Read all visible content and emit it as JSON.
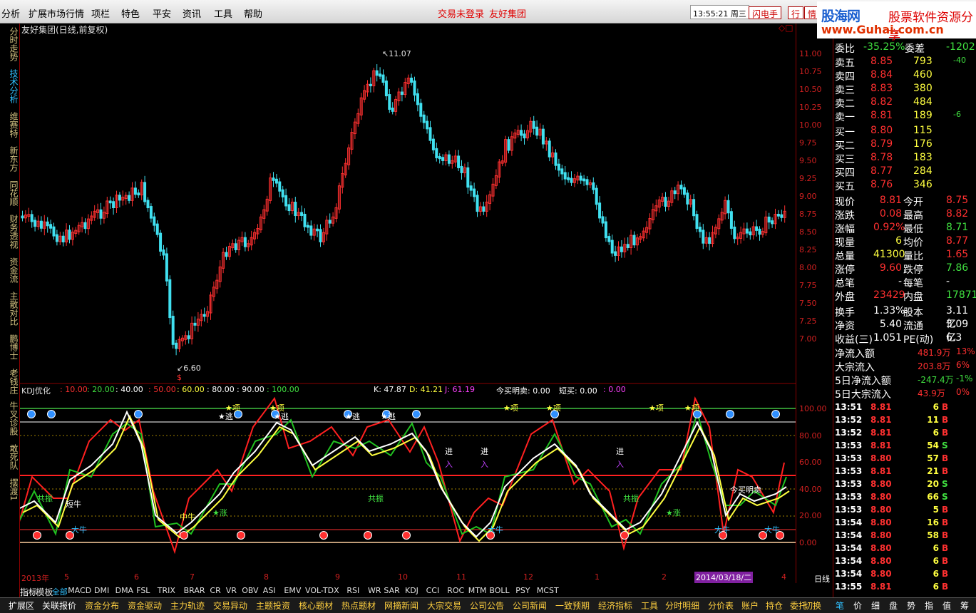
{
  "menu": {
    "items": [
      "分析",
      "扩展市场行情",
      "项栏",
      "特色",
      "平安",
      "资讯",
      "工具",
      "帮助"
    ],
    "status1": "交易未登录",
    "status2": "友好集团",
    "clock": "13:55:21 周三",
    "btn1": "闪电手",
    "btn2": "行",
    "btn3": "情"
  },
  "logo": {
    "line1": "股海网",
    "line1b": "股票软件资源分享",
    "line2": "www.Guhai.com.cn"
  },
  "sidetabs": [
    "分时走势",
    "技术分析",
    "维赛特",
    "新东方",
    "同花顺",
    "财务透视",
    "资金流",
    "主散对比",
    "鹏博士",
    "老钱庄",
    "牛叉诊股",
    "敢死队",
    "摆渡1"
  ],
  "chart": {
    "title": "友好集团(日线,前复权)",
    "high_label": "11.07",
    "low_label": "6.60",
    "low_marker": "$",
    "price_ticks": [
      "11.00",
      "10.75",
      "10.50",
      "10.25",
      "10.00",
      "9.75",
      "9.50",
      "9.25",
      "9.00",
      "8.75",
      "8.50",
      "8.25",
      "8.00",
      "7.75",
      "7.50",
      "7.25",
      "7.00"
    ],
    "ind_ticks": [
      "100.00",
      "80.00",
      "60.00",
      "40.00",
      "20.00",
      "0.00"
    ],
    "ind_header": {
      "name": "KDJ优化",
      "levels": [
        "10.00",
        "20.00",
        "40.00",
        "50.00",
        "60.00",
        "80.00",
        "90.00",
        "100.00"
      ],
      "k": "K: 47.87",
      "d": "D: 41.21",
      "j": "J: 61.19",
      "jinmai": "今买明卖: 0.00",
      "duanmai": "短买: 0.00",
      "last": "0.00"
    },
    "ind_labels": [
      "★项",
      "★项",
      "★逃",
      "★逃",
      "★逃",
      "★逃",
      "★项",
      "★项",
      "★项",
      "★项",
      "共振",
      "短牛",
      "共振",
      "共振",
      "中牛",
      "★涨",
      "★涨",
      "进",
      "入",
      "进",
      "入",
      "进",
      "入",
      "今买明卖",
      "大牛",
      "大牛",
      "大牛",
      "大牛"
    ],
    "time_labels": [
      "2013年",
      "5",
      "6",
      "7",
      "8",
      "9",
      "10",
      "11",
      "12",
      "1",
      "2",
      "3",
      "4"
    ],
    "time_highlight": "2014/03/18/二",
    "period": "日线"
  },
  "quote": {
    "wb_label": "委比",
    "wb": "-35.25%",
    "wc_label": "委差",
    "wc": "-1202",
    "asks": [
      {
        "l": "卖五",
        "p": "8.85",
        "v": "793",
        "c": "-40"
      },
      {
        "l": "卖四",
        "p": "8.84",
        "v": "460",
        "c": ""
      },
      {
        "l": "卖三",
        "p": "8.83",
        "v": "380",
        "c": ""
      },
      {
        "l": "卖二",
        "p": "8.82",
        "v": "484",
        "c": ""
      },
      {
        "l": "卖一",
        "p": "8.81",
        "v": "189",
        "c": "-6"
      }
    ],
    "bids": [
      {
        "l": "买一",
        "p": "8.80",
        "v": "115",
        "c": ""
      },
      {
        "l": "买二",
        "p": "8.79",
        "v": "176",
        "c": ""
      },
      {
        "l": "买三",
        "p": "8.78",
        "v": "183",
        "c": ""
      },
      {
        "l": "买四",
        "p": "8.77",
        "v": "284",
        "c": ""
      },
      {
        "l": "买五",
        "p": "8.76",
        "v": "346",
        "c": ""
      }
    ],
    "stats": [
      [
        "现价",
        "8.81",
        "今开",
        "8.75"
      ],
      [
        "涨跌",
        "0.08",
        "最高",
        "8.82"
      ],
      [
        "涨幅",
        "0.92%",
        "最低",
        "8.71"
      ],
      [
        "现量",
        "6",
        "均价",
        "8.77"
      ],
      [
        "总量",
        "41300",
        "量比",
        "1.65"
      ],
      [
        "涨停",
        "9.60",
        "跌停",
        "7.86"
      ],
      [
        "总笔",
        "-",
        "每笔",
        "-"
      ],
      [
        "外盘",
        "23429",
        "内盘",
        "17871"
      ],
      [
        "换手",
        "1.33%",
        "股本",
        "3.11亿"
      ],
      [
        "净资",
        "5.40",
        "流通",
        "3.09亿"
      ],
      [
        "收益(三)",
        "1.051",
        "PE(动)",
        "6.3"
      ]
    ],
    "flows": [
      [
        "净流入额",
        "481.9万",
        "13%"
      ],
      [
        "大宗流入",
        "203.8万",
        "6%"
      ],
      [
        "5日净流入额",
        "-247.4万",
        "-1%"
      ],
      [
        "5日大宗流入",
        "43.9万",
        "0%"
      ]
    ],
    "ticks": [
      [
        "13:51",
        "8.81",
        "6",
        "B"
      ],
      [
        "13:52",
        "8.81",
        "11",
        "B"
      ],
      [
        "13:52",
        "8.81",
        "6",
        "B"
      ],
      [
        "13:53",
        "8.81",
        "54",
        "S"
      ],
      [
        "13:53",
        "8.80",
        "57",
        "B"
      ],
      [
        "13:53",
        "8.81",
        "21",
        "B"
      ],
      [
        "13:53",
        "8.80",
        "20",
        "S"
      ],
      [
        "13:53",
        "8.80",
        "66",
        "S"
      ],
      [
        "13:53",
        "8.80",
        "5",
        "B"
      ],
      [
        "13:54",
        "8.80",
        "16",
        "B"
      ],
      [
        "13:54",
        "8.80",
        "58",
        "B"
      ],
      [
        "13:54",
        "8.80",
        "6",
        "B"
      ],
      [
        "13:54",
        "8.80",
        "6",
        "B"
      ],
      [
        "13:54",
        "8.80",
        "6",
        "B"
      ],
      [
        "13:55",
        "8.81",
        "6",
        "B"
      ]
    ]
  },
  "bottomtabs": [
    "指标",
    "模板",
    "全部",
    "MACD",
    "DMI",
    "DMA",
    "FSL",
    "TRIX",
    "BRAR",
    "CR",
    "VR",
    "OBV",
    "ASI",
    "EMV",
    "VOL-TDX",
    "RSI",
    "WR",
    "SAR",
    "KDJ",
    "CCI",
    "ROC",
    "MTM",
    "BOLL",
    "PSY",
    "MCST"
  ],
  "bottombar": [
    "扩展区",
    "关联报价",
    "资金分布",
    "资金驱动",
    "主力轨迹",
    "交易异动",
    "主题投资",
    "核心题材",
    "热点题材",
    "网摘新闻",
    "大宗交易",
    "公司公告",
    "公司新闻",
    "一致预期",
    "经济指标",
    "工具",
    "分时明细",
    "分价表",
    "账户",
    "持仓",
    "委托",
    "切换"
  ],
  "rightbottom": [
    "笔",
    "价",
    "细",
    "盘",
    "势",
    "指",
    "值",
    "筹"
  ],
  "colors": {
    "up": "#ff3030",
    "down": "#40e0f0",
    "k": "#ffffff",
    "d": "#ffff40",
    "j": "#ff2020"
  }
}
